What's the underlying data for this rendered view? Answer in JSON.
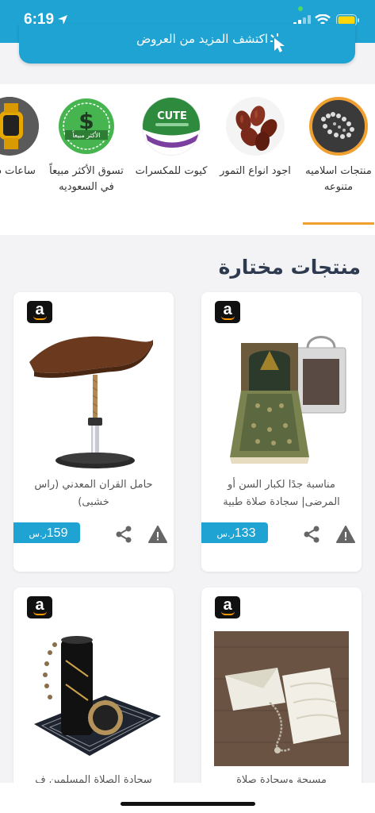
{
  "status_bar": {
    "time": "6:19"
  },
  "banner": {
    "text": "اكتشف المزيد من العروض"
  },
  "categories": [
    {
      "label": "منتجات اسلاميه متنوعه",
      "icon": "prayer-beads"
    },
    {
      "label": "اجود انواع التمور",
      "icon": "dates"
    },
    {
      "label": "كيوت للمكسرات",
      "icon": "cute-nuts-logo",
      "logo_text": "CUTE"
    },
    {
      "label": "تسوق الأكثر مبيعاً في السعوديه",
      "icon": "best-seller-badge",
      "badge_text": "الأكثر مبيعاً"
    },
    {
      "label": "ساعات ذكية",
      "icon": "smartwatch"
    }
  ],
  "section": {
    "title": "منتجات مختارة"
  },
  "products": [
    {
      "title": "مناسبة جدًا لكبار السن أو المرضى| سجادة صلاة طبية",
      "price": "133",
      "currency": "ر.س",
      "image": "prayer-mat-with-bag"
    },
    {
      "title": "حامل القران المعدني (راس خشبى)",
      "price": "159",
      "currency": "ر.س",
      "image": "quran-stand"
    },
    {
      "title": "مسبحة وسجادة صلاة",
      "price": "",
      "currency": "",
      "image": "white-prayer-mat-beads"
    },
    {
      "title": "سجادة الصلاة المسلمين ف",
      "price": "",
      "currency": "",
      "image": "prayer-mat-set-black"
    }
  ],
  "badges": {
    "amazon": "a"
  },
  "colors": {
    "primary": "#1fa3d3",
    "accent": "#f0a030",
    "title": "#2d3a4f"
  }
}
